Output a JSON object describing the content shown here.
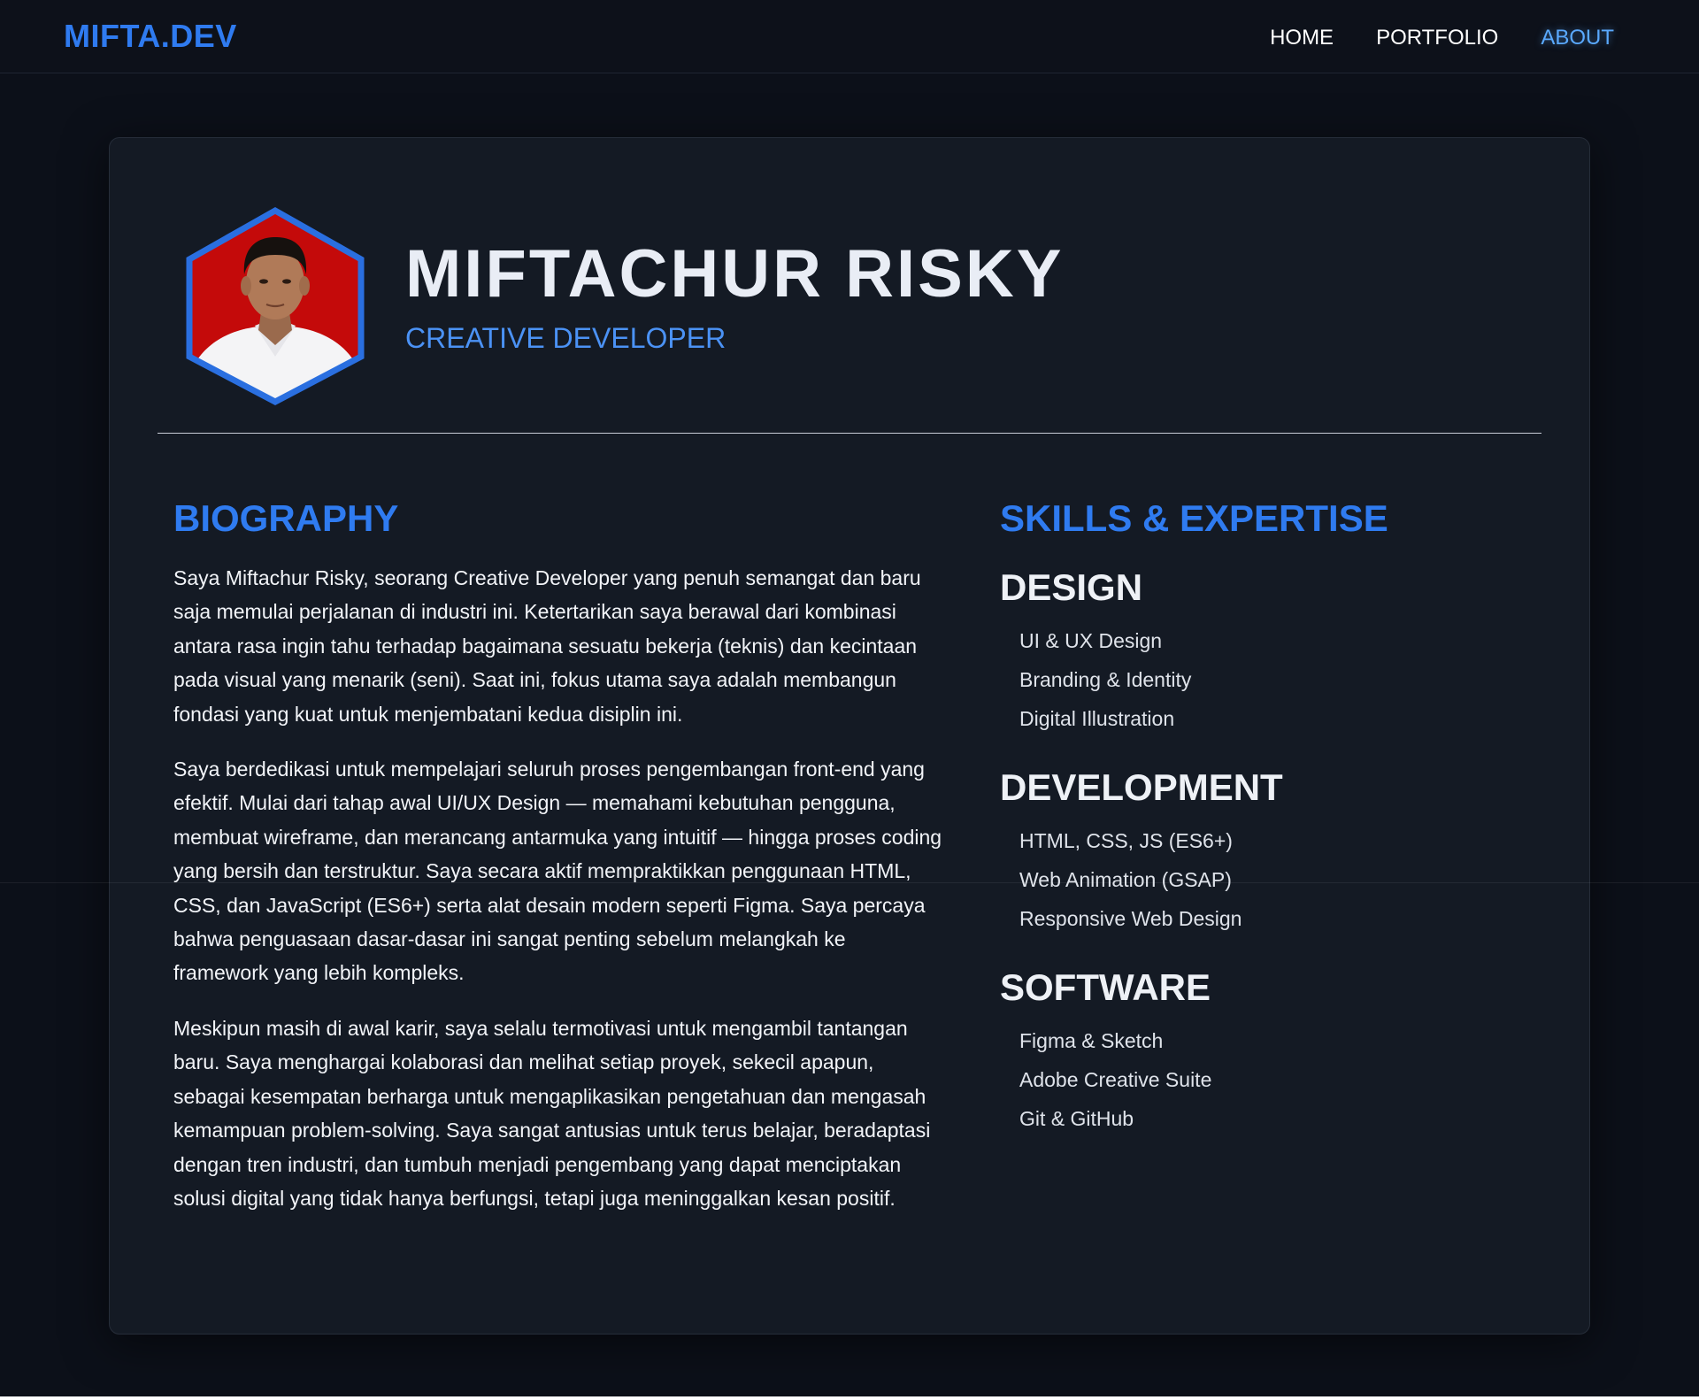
{
  "navbar": {
    "logo": "MIFTA.DEV",
    "links": [
      {
        "label": "HOME"
      },
      {
        "label": "PORTFOLIO"
      },
      {
        "label": "ABOUT"
      }
    ]
  },
  "profile": {
    "name": "MIFTACHUR RISKY",
    "role": "CREATIVE DEVELOPER",
    "photo_icon": "profile-photo-hexagon"
  },
  "biography": {
    "title": "BIOGRAPHY",
    "paragraphs": [
      "Saya Miftachur Risky, seorang Creative Developer yang penuh semangat dan baru saja memulai perjalanan di industri ini. Ketertarikan saya berawal dari kombinasi antara rasa ingin tahu terhadap bagaimana sesuatu bekerja (teknis) dan kecintaan pada visual yang menarik (seni). Saat ini, fokus utama saya adalah membangun fondasi yang kuat untuk menjembatani kedua disiplin ini.",
      "Saya berdedikasi untuk mempelajari seluruh proses pengembangan front-end yang efektif. Mulai dari tahap awal UI/UX Design — memahami kebutuhan pengguna, membuat wireframe, dan merancang antarmuka yang intuitif — hingga proses coding yang bersih dan terstruktur. Saya secara aktif mempraktikkan penggunaan HTML, CSS, dan JavaScript (ES6+) serta alat desain modern seperti Figma. Saya percaya bahwa penguasaan dasar-dasar ini sangat penting sebelum melangkah ke framework yang lebih kompleks.",
      "Meskipun masih di awal karir, saya selalu termotivasi untuk mengambil tantangan baru. Saya menghargai kolaborasi dan melihat setiap proyek, sekecil apapun, sebagai kesempatan berharga untuk mengaplikasikan pengetahuan dan mengasah kemampuan problem-solving. Saya sangat antusias untuk terus belajar, beradaptasi dengan tren industri, dan tumbuh menjadi pengembang yang dapat menciptakan solusi digital yang tidak hanya berfungsi, tetapi juga meninggalkan kesan positif."
    ]
  },
  "skills": {
    "title": "SKILLS & EXPERTISE",
    "groups": [
      {
        "title": "DESIGN",
        "items": [
          "UI & UX Design",
          "Branding & Identity",
          "Digital Illustration"
        ]
      },
      {
        "title": "DEVELOPMENT",
        "items": [
          "HTML, CSS, JS (ES6+)",
          "Web Animation (GSAP)",
          "Responsive Web Design"
        ]
      },
      {
        "title": "SOFTWARE",
        "items": [
          "Figma & Sketch",
          "Adobe Creative Suite",
          "Git & GitHub"
        ]
      }
    ]
  },
  "colors": {
    "accent": "#2f7bf0",
    "active_link": "#5aa9ff",
    "background": "#0c1019",
    "card": "#141a24",
    "photo_background": "#c40a0a"
  }
}
